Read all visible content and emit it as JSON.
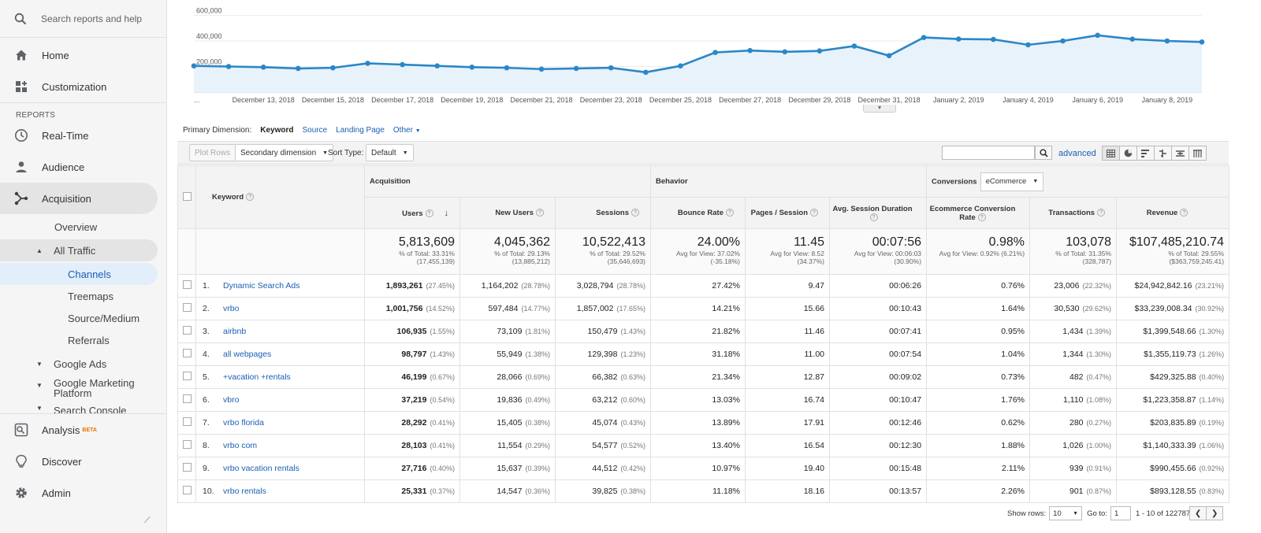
{
  "sidebar": {
    "search_placeholder": "Search reports and help",
    "home": "Home",
    "customization": "Customization",
    "reports_label": "REPORTS",
    "realtime": "Real-Time",
    "audience": "Audience",
    "acquisition": "Acquisition",
    "overview": "Overview",
    "all_traffic": "All Traffic",
    "channels": "Channels",
    "treemaps": "Treemaps",
    "source_medium": "Source/Medium",
    "referrals": "Referrals",
    "google_ads": "Google Ads",
    "gmp_line1": "Google Marketing",
    "gmp_line2": "Platform",
    "search_console": "Search Console",
    "analysis": "Analysis",
    "analysis_badge": "BETA",
    "discover": "Discover",
    "admin": "Admin"
  },
  "chart_data": {
    "type": "area",
    "yticks": [
      "200,000",
      "400,000",
      "600,000"
    ],
    "ylim": [
      0,
      720000
    ],
    "x_labels": [
      "December 13, 2018",
      "December 15, 2018",
      "December 17, 2018",
      "December 19, 2018",
      "December 21, 2018",
      "December 23, 2018",
      "December 25, 2018",
      "December 27, 2018",
      "December 29, 2018",
      "December 31, 2018",
      "January 2, 2019",
      "January 4, 2019",
      "January 6, 2019",
      "January 8, 2019"
    ],
    "x_first_label": "...",
    "values": [
      205000,
      200000,
      195000,
      185000,
      190000,
      225000,
      215000,
      205000,
      195000,
      190000,
      180000,
      185000,
      190000,
      155000,
      205000,
      310000,
      325000,
      315000,
      322000,
      360000,
      285000,
      427000,
      415000,
      412000,
      370000,
      400000,
      444000,
      414000,
      400000,
      392000
    ],
    "color": "#2a87c7",
    "fill": "#e8f2fa"
  },
  "primary": {
    "label": "Primary Dimension:",
    "active": "Keyword",
    "options": [
      "Source",
      "Landing Page",
      "Other"
    ]
  },
  "toolbar": {
    "plot_rows": "Plot Rows",
    "secondary": "Secondary dimension",
    "sort_label": "Sort Type:",
    "sort_value": "Default",
    "advanced": "advanced"
  },
  "table": {
    "keyword_header": "Keyword",
    "groups": {
      "acquisition": "Acquisition",
      "behavior": "Behavior",
      "conversions": "Conversions",
      "conversions_select": "eCommerce"
    },
    "columns": [
      "Users",
      "New Users",
      "Sessions",
      "Bounce Rate",
      "Pages / Session",
      "Avg. Session Duration",
      "Ecommerce Conversion Rate",
      "Transactions",
      "Revenue"
    ],
    "totals": [
      {
        "v": "5,813,609",
        "s1": "% of Total: 33.31%",
        "s2": "(17,455,139)"
      },
      {
        "v": "4,045,362",
        "s1": "% of Total: 29.13%",
        "s2": "(13,885,212)"
      },
      {
        "v": "10,522,413",
        "s1": "% of Total: 29.52%",
        "s2": "(35,646,693)"
      },
      {
        "v": "24.00%",
        "s1": "Avg for View: 37.02%",
        "s2": "(-35.18%)"
      },
      {
        "v": "11.45",
        "s1": "Avg for View: 8.52",
        "s2": "(34.37%)"
      },
      {
        "v": "00:07:56",
        "s1": "Avg for View: 00:06:03",
        "s2": "(30.90%)"
      },
      {
        "v": "0.98%",
        "s1": "Avg for View: 0.92% (6.21%)",
        "s2": ""
      },
      {
        "v": "103,078",
        "s1": "% of Total: 31.35%",
        "s2": "(328,787)"
      },
      {
        "v": "$107,485,210.74",
        "s1": "% of Total: 29.55%",
        "s2": "($363,759,245.41)"
      }
    ],
    "rows": [
      {
        "n": "1.",
        "kw": "Dynamic Search Ads",
        "users": "1,893,261",
        "users_p": "(27.45%)",
        "new": "1,164,202",
        "new_p": "(28.78%)",
        "sess": "3,028,794",
        "sess_p": "(28.78%)",
        "bounce": "27.42%",
        "pages": "9.47",
        "dur": "00:06:26",
        "conv": "0.76%",
        "trans": "23,006",
        "trans_p": "(22.32%)",
        "rev": "$24,942,842.16",
        "rev_p": "(23.21%)"
      },
      {
        "n": "2.",
        "kw": "vrbo",
        "users": "1,001,756",
        "users_p": "(14.52%)",
        "new": "597,484",
        "new_p": "(14.77%)",
        "sess": "1,857,002",
        "sess_p": "(17.65%)",
        "bounce": "14.21%",
        "pages": "15.66",
        "dur": "00:10:43",
        "conv": "1.64%",
        "trans": "30,530",
        "trans_p": "(29.62%)",
        "rev": "$33,239,008.34",
        "rev_p": "(30.92%)"
      },
      {
        "n": "3.",
        "kw": "airbnb",
        "users": "106,935",
        "users_p": "(1.55%)",
        "new": "73,109",
        "new_p": "(1.81%)",
        "sess": "150,479",
        "sess_p": "(1.43%)",
        "bounce": "21.82%",
        "pages": "11.46",
        "dur": "00:07:41",
        "conv": "0.95%",
        "trans": "1,434",
        "trans_p": "(1.39%)",
        "rev": "$1,399,548.66",
        "rev_p": "(1.30%)"
      },
      {
        "n": "4.",
        "kw": "all webpages",
        "users": "98,797",
        "users_p": "(1.43%)",
        "new": "55,949",
        "new_p": "(1.38%)",
        "sess": "129,398",
        "sess_p": "(1.23%)",
        "bounce": "31.18%",
        "pages": "11.00",
        "dur": "00:07:54",
        "conv": "1.04%",
        "trans": "1,344",
        "trans_p": "(1.30%)",
        "rev": "$1,355,119.73",
        "rev_p": "(1.26%)"
      },
      {
        "n": "5.",
        "kw": "+vacation +rentals",
        "users": "46,199",
        "users_p": "(0.67%)",
        "new": "28,066",
        "new_p": "(0.69%)",
        "sess": "66,382",
        "sess_p": "(0.63%)",
        "bounce": "21.34%",
        "pages": "12.87",
        "dur": "00:09:02",
        "conv": "0.73%",
        "trans": "482",
        "trans_p": "(0.47%)",
        "rev": "$429,325.88",
        "rev_p": "(0.40%)"
      },
      {
        "n": "6.",
        "kw": "vbro",
        "users": "37,219",
        "users_p": "(0.54%)",
        "new": "19,836",
        "new_p": "(0.49%)",
        "sess": "63,212",
        "sess_p": "(0.60%)",
        "bounce": "13.03%",
        "pages": "16.74",
        "dur": "00:10:47",
        "conv": "1.76%",
        "trans": "1,110",
        "trans_p": "(1.08%)",
        "rev": "$1,223,358.87",
        "rev_p": "(1.14%)"
      },
      {
        "n": "7.",
        "kw": "vrbo florida",
        "users": "28,292",
        "users_p": "(0.41%)",
        "new": "15,405",
        "new_p": "(0.38%)",
        "sess": "45,074",
        "sess_p": "(0.43%)",
        "bounce": "13.89%",
        "pages": "17.91",
        "dur": "00:12:46",
        "conv": "0.62%",
        "trans": "280",
        "trans_p": "(0.27%)",
        "rev": "$203,835.89",
        "rev_p": "(0.19%)"
      },
      {
        "n": "8.",
        "kw": "vrbo com",
        "users": "28,103",
        "users_p": "(0.41%)",
        "new": "11,554",
        "new_p": "(0.29%)",
        "sess": "54,577",
        "sess_p": "(0.52%)",
        "bounce": "13.40%",
        "pages": "16.54",
        "dur": "00:12:30",
        "conv": "1.88%",
        "trans": "1,026",
        "trans_p": "(1.00%)",
        "rev": "$1,140,333.39",
        "rev_p": "(1.06%)"
      },
      {
        "n": "9.",
        "kw": "vrbo vacation rentals",
        "users": "27,716",
        "users_p": "(0.40%)",
        "new": "15,637",
        "new_p": "(0.39%)",
        "sess": "44,512",
        "sess_p": "(0.42%)",
        "bounce": "10.97%",
        "pages": "19.40",
        "dur": "00:15:48",
        "conv": "2.11%",
        "trans": "939",
        "trans_p": "(0.91%)",
        "rev": "$990,455.66",
        "rev_p": "(0.92%)"
      },
      {
        "n": "10.",
        "kw": "vrbo rentals",
        "users": "25,331",
        "users_p": "(0.37%)",
        "new": "14,547",
        "new_p": "(0.36%)",
        "sess": "39,825",
        "sess_p": "(0.38%)",
        "bounce": "11.18%",
        "pages": "18.16",
        "dur": "00:13:57",
        "conv": "2.26%",
        "trans": "901",
        "trans_p": "(0.87%)",
        "rev": "$893,128.55",
        "rev_p": "(0.83%)"
      }
    ]
  },
  "pager": {
    "show_rows_label": "Show rows:",
    "show_rows_value": "10",
    "goto_label": "Go to:",
    "goto_value": "1",
    "range": "1 - 10 of 122787"
  }
}
